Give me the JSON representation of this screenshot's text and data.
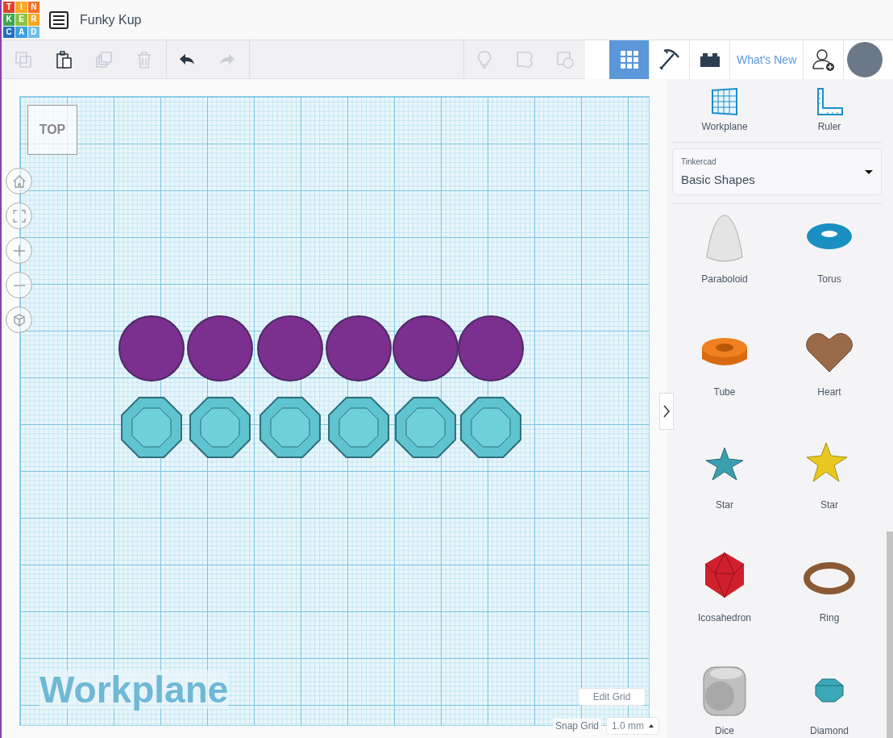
{
  "logo": {
    "letters": [
      "T",
      "I",
      "N",
      "K",
      "E",
      "R",
      "C",
      "A",
      "D"
    ]
  },
  "window": {
    "title": "Funky Kup"
  },
  "toolbar": {
    "edit_tools": [
      {
        "kind": "copy",
        "disabled": true
      },
      {
        "kind": "paste",
        "disabled": false
      },
      {
        "kind": "duplicate",
        "disabled": true
      },
      {
        "kind": "delete",
        "disabled": true
      }
    ],
    "history": [
      {
        "kind": "undo",
        "disabled": false
      },
      {
        "kind": "redo",
        "disabled": true
      }
    ],
    "shape_tools": [
      {
        "kind": "notes",
        "disabled": true
      },
      {
        "kind": "group",
        "disabled": true
      },
      {
        "kind": "ungroup",
        "disabled": true
      }
    ]
  },
  "view_tabs": [
    {
      "kind": "grid",
      "selected": true
    },
    {
      "kind": "pickaxe",
      "selected": false
    },
    {
      "kind": "brick",
      "selected": false
    }
  ],
  "whats_new": "What's New",
  "view_cube": {
    "label": "TOP"
  },
  "watermark": "Workplane",
  "edit_grid": "Edit Grid",
  "snap_grid": {
    "label": "Snap Grid",
    "value": "1.0 mm"
  },
  "panel": {
    "tools": [
      {
        "kind": "workplane",
        "label": "Workplane"
      },
      {
        "kind": "ruler",
        "label": "Ruler"
      }
    ],
    "library": {
      "source": "Tinkercad",
      "value": "Basic Shapes"
    },
    "shapes": [
      {
        "kind": "paraboloid",
        "label": "Paraboloid"
      },
      {
        "kind": "torus",
        "label": "Torus"
      },
      {
        "kind": "tube",
        "label": "Tube"
      },
      {
        "kind": "heart",
        "label": "Heart"
      },
      {
        "kind": "star-flat",
        "label": "Star"
      },
      {
        "kind": "star-solid",
        "label": "Star"
      },
      {
        "kind": "icosahedron",
        "label": "Icosahedron"
      },
      {
        "kind": "ring",
        "label": "Ring"
      },
      {
        "kind": "dice",
        "label": "Dice"
      },
      {
        "kind": "diamond",
        "label": "Diamond"
      }
    ]
  }
}
